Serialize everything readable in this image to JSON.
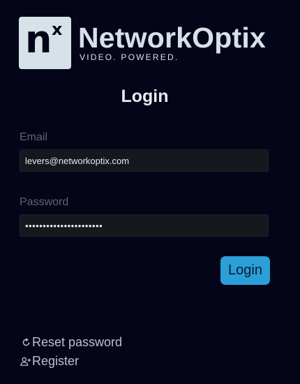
{
  "brand": {
    "logo_mark_letter": "n",
    "logo_mark_superscript": "x",
    "name": "NetworkOptix",
    "tagline": "VIDEO. POWERED."
  },
  "form": {
    "title": "Login",
    "email": {
      "label": "Email",
      "value": "levers@networkoptix.com"
    },
    "password": {
      "label": "Password",
      "value": "••••••••••••••••••••••"
    },
    "submit_label": "Login"
  },
  "links": {
    "reset_password": {
      "label": "Reset password",
      "icon": "refresh-icon"
    },
    "register": {
      "label": "Register",
      "icon": "user-add-icon"
    }
  },
  "colors": {
    "background": "#05051a",
    "accent": "#2a9fd8",
    "logo": "#d7e1e8",
    "label": "#5b6674",
    "link": "#b9c2cc"
  }
}
